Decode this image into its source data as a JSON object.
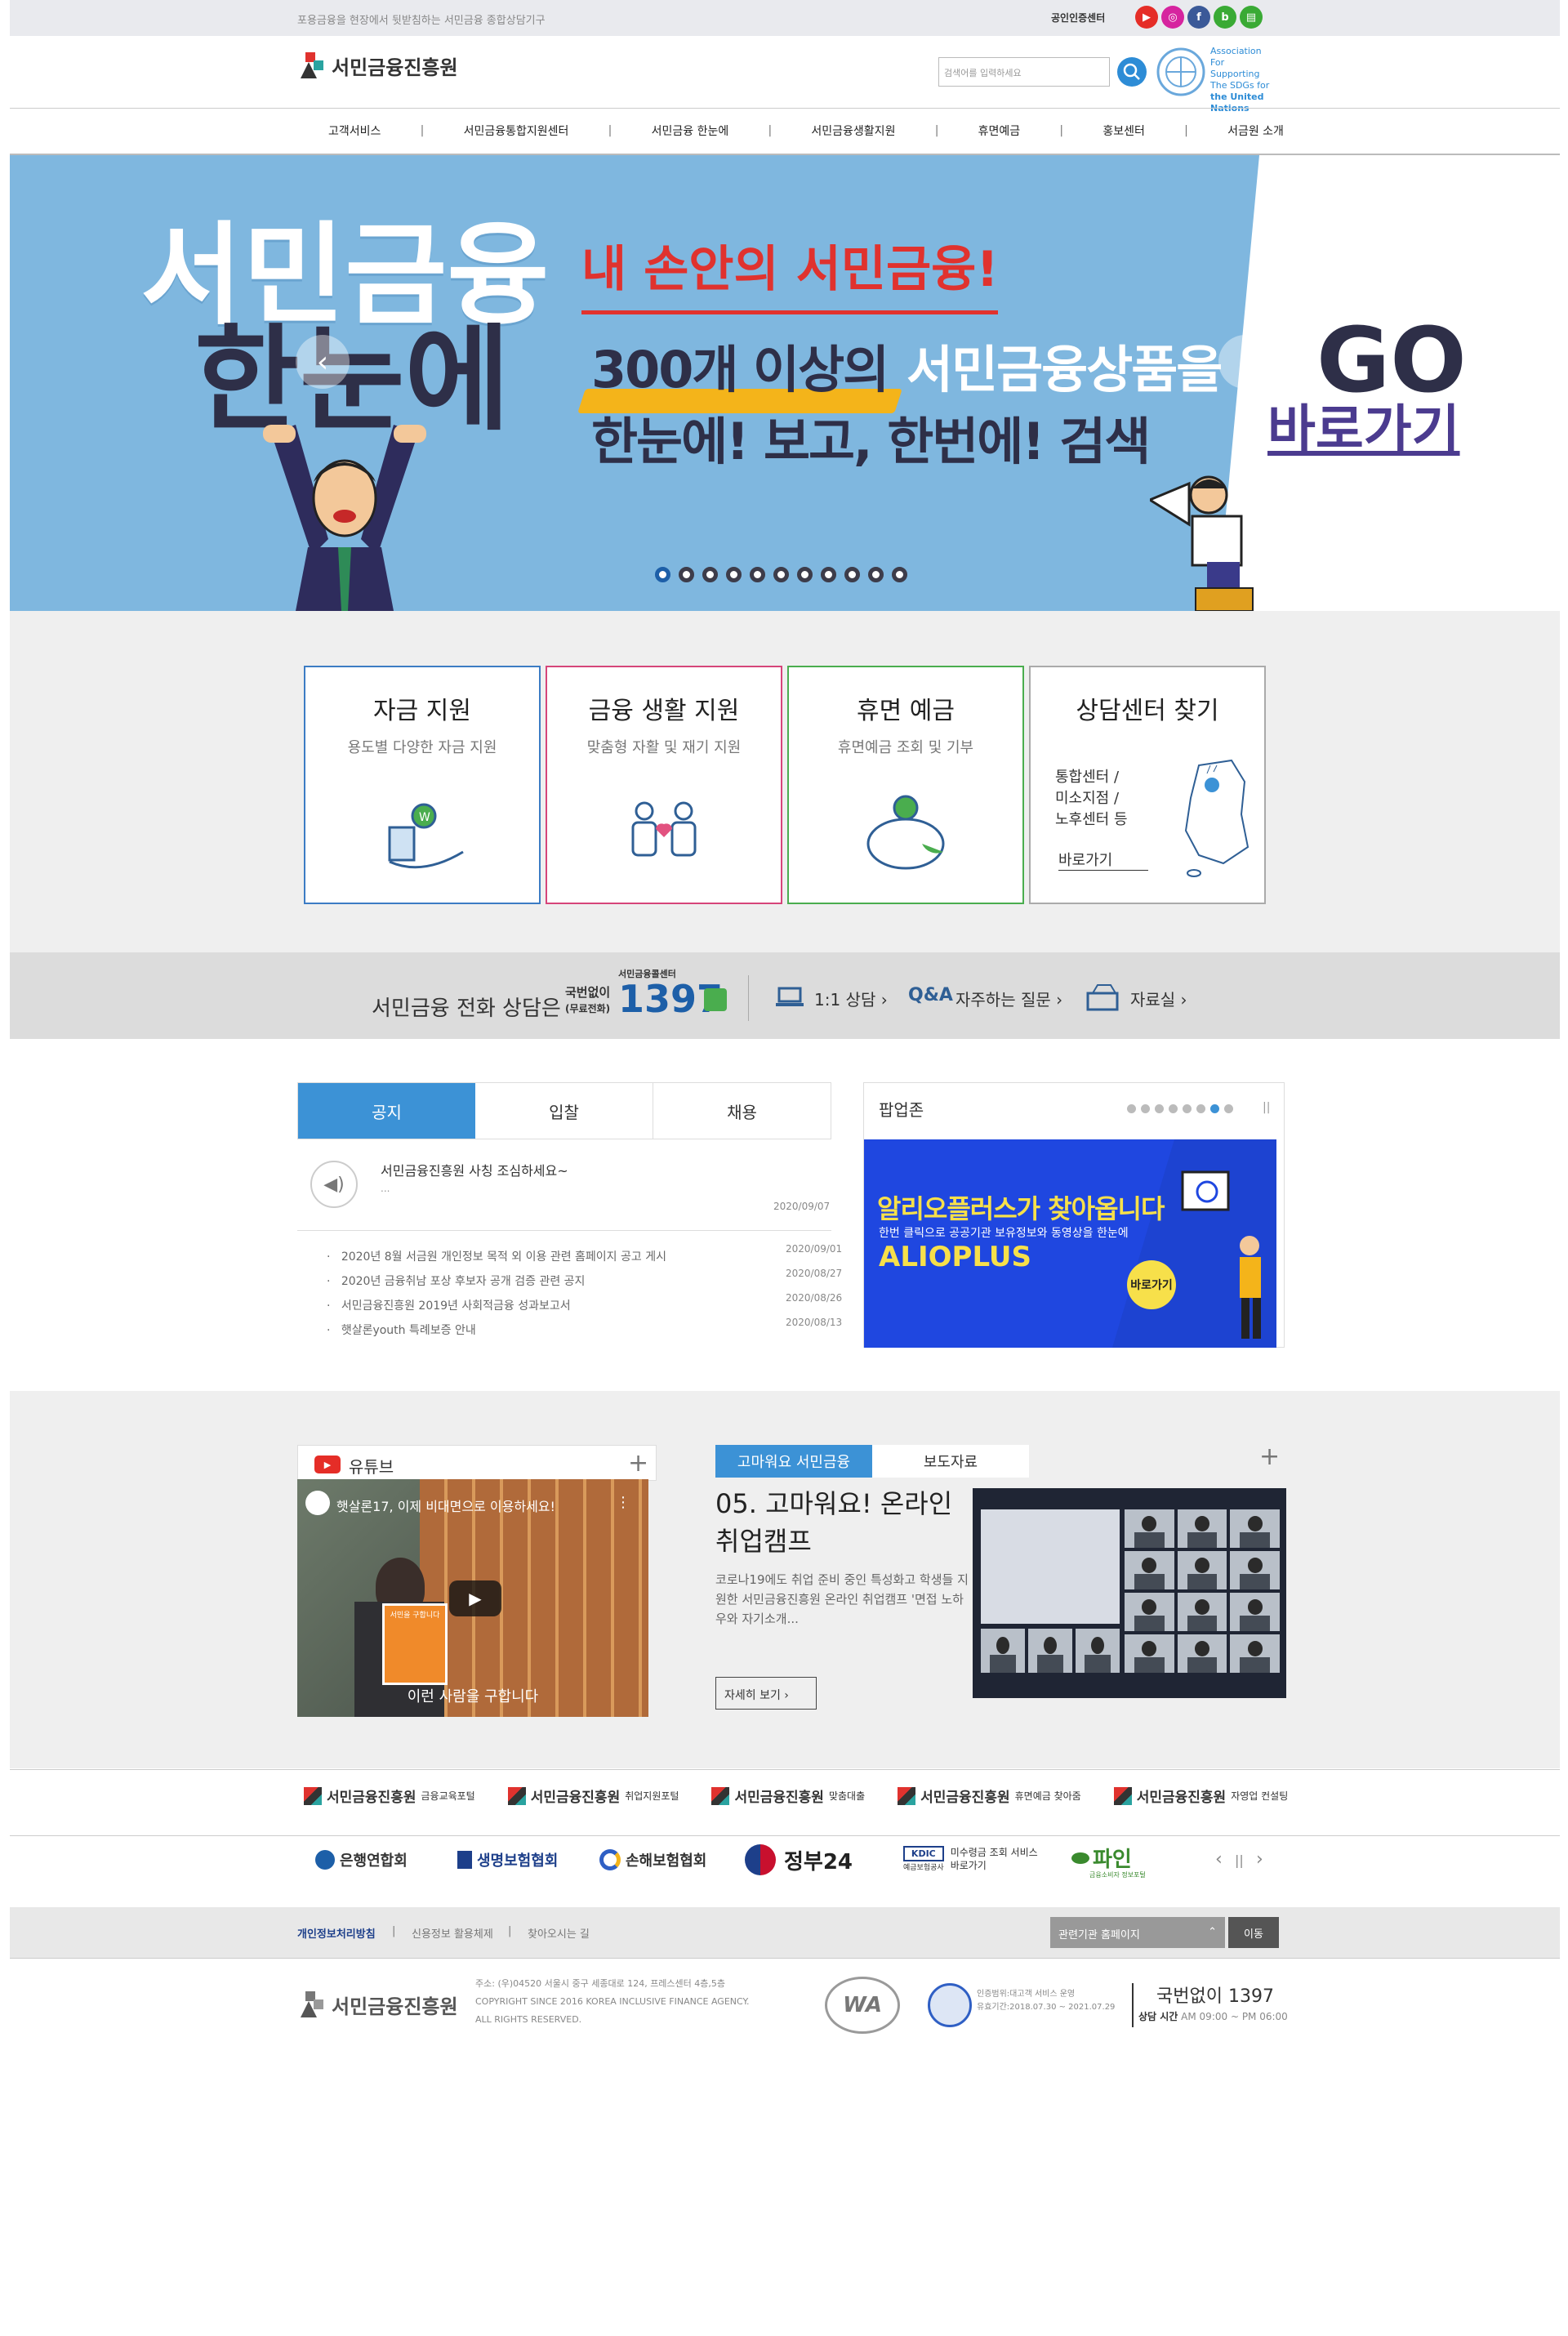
{
  "top": {
    "slogan": "포용금융을 현장에서 뒷받침하는 서민금융 종합상담기구",
    "cert_center": "공인인증센터",
    "sns": [
      "youtube-icon",
      "instagram-icon",
      "facebook-icon",
      "blog-icon",
      "post-icon"
    ]
  },
  "header": {
    "logo": "서민금융진흥원",
    "search_placeholder": "검색어를 입력하세요",
    "un_text": [
      "Association",
      "For Supporting",
      "The SDGs for",
      "the United",
      "Nations"
    ]
  },
  "gnb": [
    "고객서비스",
    "서민금융통합지원센터",
    "서민금융 한눈에",
    "서민금융생활지원",
    "휴면예금",
    "홍보센터",
    "서금원 소개"
  ],
  "hero": {
    "left_line1": "서민금융",
    "left_line2": "한눈에",
    "headline": "내 손안의 서민금융!",
    "line2_a": "300개 이상의",
    "line2_b": "서민금융상품을",
    "line3": "한눈에! 보고, 한번에!  검색",
    "go": "GO",
    "go_sub": "바로가기",
    "slide_count": 11,
    "active_slide": 1,
    "prev": "‹",
    "next": "›"
  },
  "quick": [
    {
      "title": "자금 지원",
      "sub": "용도별 다양한 자금 지원",
      "color": "#3c7cc4"
    },
    {
      "title": "금융 생활 지원",
      "sub": "맞춤형 자활 및 재기 지원",
      "color": "#d6457a"
    },
    {
      "title": "휴면 예금",
      "sub": "휴면예금 조회 및 기부",
      "color": "#4aad4e"
    },
    {
      "title": "상담센터 찾기",
      "sub": "",
      "color": "#999999",
      "list": [
        "통합센터 /",
        "미소지점 /",
        "노후센터 등"
      ],
      "link": "바로가기"
    }
  ],
  "callbar": {
    "label": "서민금융 전화 상담은",
    "center": "서민금융콜센터",
    "free_a": "국번없이",
    "free_b": "(무료전화)",
    "number": "1397",
    "links": [
      "1:1 상담 ›",
      "자주하는 질문 ›",
      "자료실 ›"
    ]
  },
  "board": {
    "tabs": [
      "공지",
      "입찰",
      "채용"
    ],
    "featured_title": "서민금융진흥원 사칭 조심하세요~",
    "featured_sub": "...",
    "featured_date": "2020/09/07",
    "items": [
      {
        "title": "2020년 8월 서금원 개인정보 목적 외 이용 관련 홈페이지 공고 게시",
        "date": "2020/09/01"
      },
      {
        "title": "2020년 금융취남 포상 후보자 공개 검증 관련 공지",
        "date": "2020/08/27"
      },
      {
        "title": "서민금융진흥원 2019년 사회적금융 성과보고서",
        "date": "2020/08/26"
      },
      {
        "title": "햇살론youth 특례보증 안내",
        "date": "2020/08/13"
      }
    ]
  },
  "popup": {
    "title": "팝업존",
    "pause": "||",
    "dot_count": 8,
    "active_dot": 7,
    "banner_title": "알리오플러스가 찾아옵니다",
    "banner_sub": "한번 클릭으로 공공기관 보유정보와 동영상을 한눈에",
    "banner_brand": "ALIOPLUS",
    "banner_btn": "바로가기"
  },
  "youtube": {
    "label": "유튜브",
    "plus": "+",
    "video_title": "햇살론17, 이제 비대면으로 이용하세요!",
    "caption": "이런 사람을 구합니다",
    "sign": "서민을 구합니다"
  },
  "press": {
    "tabs": [
      "고마워요 서민금융",
      "보도자료"
    ],
    "plus": "+",
    "title": "05. 고마워요! 온라인 취업캠프",
    "desc": "코로나19에도 취업 준비 중인 특성화고 학생들 지원한 서민금융진흥원 온라인 취업캠프 '면접 노하우와 자기소개...",
    "more": "자세히 보기 ›"
  },
  "family": [
    {
      "logo": "서민금융진흥원",
      "sub": "금융교육포털"
    },
    {
      "logo": "서민금융진흥원",
      "sub": "취업지원포털"
    },
    {
      "logo": "서민금융진흥원",
      "sub": "맞춤대출"
    },
    {
      "logo": "서민금융진흥원",
      "sub": "휴면예금 찾아줌"
    },
    {
      "logo": "서민금융진흥원",
      "sub": "자영업 컨설팅"
    }
  ],
  "orgs": [
    "은행연합회",
    "생명보험협회",
    "손해보험협회",
    "정부24",
    "미수령금 조회 서비스 바로가기",
    "파인"
  ],
  "org_extra": {
    "kdic": "KDIC",
    "kdic_sub": "예금보험공사",
    "fine_sub": "금융소비자 정보포털"
  },
  "org_nav": {
    "prev": "‹",
    "pause": "||",
    "next": "›"
  },
  "footer": {
    "links": [
      "개인정보처리방침",
      "신용정보 활용체제",
      "찾아오시는 길"
    ],
    "related": "관련기관 홈페이지",
    "go": "이동",
    "logo": "서민금융진흥원",
    "address": "주소: (우)04520 서울시 중구 세종대로 124, 프레스센터 4층,5층",
    "copyright1": "COPYRIGHT SINCE 2016 KOREA INCLUSIVE FINANCE AGENCY.",
    "copyright2": "ALL RIGHTS RESERVED.",
    "wa": "WA",
    "cert_text1": "인증범위:대고객 서비스 운영",
    "cert_text2": "유효기간:2018.07.30 ~ 2021.07.29",
    "phone": "국번없이 1397",
    "hours_label": "상담 시간",
    "hours": "AM 09:00 ~ PM 06:00"
  }
}
